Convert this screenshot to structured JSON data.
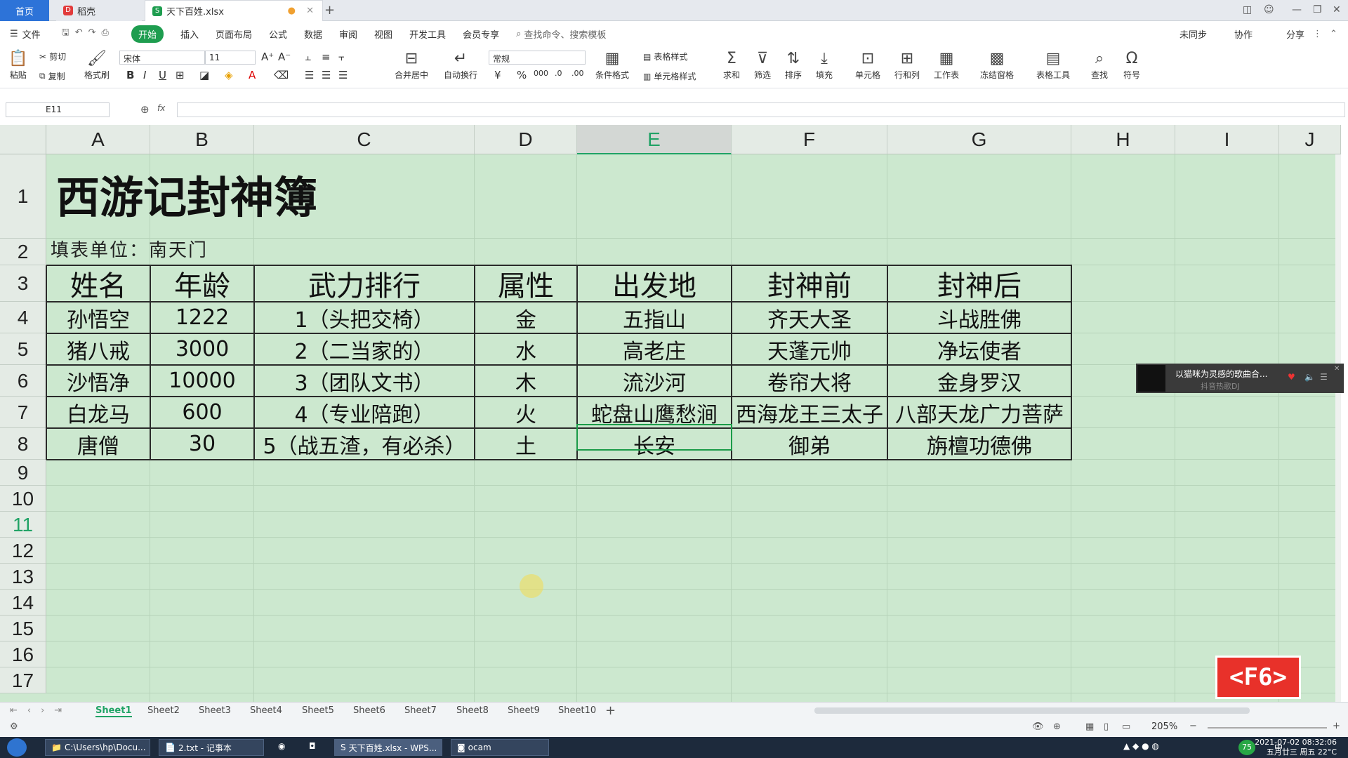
{
  "tabs": {
    "home": "首页",
    "daoke": "稻壳",
    "file": "天下百姓.xlsx"
  },
  "menu": [
    "文件",
    "开始",
    "插入",
    "页面布局",
    "公式",
    "数据",
    "审阅",
    "视图",
    "开发工具",
    "会员专享"
  ],
  "menu_search": "查找命令、搜索模板",
  "menu_right": [
    "未同步",
    "协作",
    "分享"
  ],
  "ribbon": {
    "paste": "粘贴",
    "cut": "剪切",
    "copy": "复制",
    "format_painter": "格式刷",
    "font": "宋体",
    "size": "11",
    "numfmt": "常规",
    "merge": "合并居中",
    "wrap": "自动换行",
    "cond_fmt": "条件格式",
    "table_style": "表格样式",
    "cell_style": "单元格样式",
    "sum": "求和",
    "filter": "筛选",
    "sort": "排序",
    "fill": "填充",
    "cell": "单元格",
    "rowcol": "行和列",
    "worksheet": "工作表",
    "freeze": "冻结窗格",
    "tools": "表格工具",
    "find": "查找",
    "symbol": "符号"
  },
  "namebox": "E11",
  "fx": "fx",
  "columns": [
    "A",
    "B",
    "C",
    "D",
    "E",
    "F",
    "G",
    "H",
    "I",
    "J"
  ],
  "rows": [
    "1",
    "2",
    "3",
    "4",
    "5",
    "6",
    "7",
    "8",
    "9",
    "10",
    "11",
    "12",
    "13",
    "14",
    "15",
    "16",
    "17"
  ],
  "title": "西游记封神簿",
  "unit": "填表单位：南天门",
  "headers": [
    "姓名",
    "年龄",
    "武力排行",
    "属性",
    "出发地",
    "封神前",
    "封神后"
  ],
  "data": [
    [
      "孙悟空",
      "1222",
      "1（头把交椅）",
      "金",
      "五指山",
      "齐天大圣",
      "斗战胜佛"
    ],
    [
      "猪八戒",
      "3000",
      "2（二当家的）",
      "水",
      "高老庄",
      "天蓬元帅",
      "净坛使者"
    ],
    [
      "沙悟净",
      "10000",
      "3（团队文书）",
      "木",
      "流沙河",
      "卷帘大将",
      "金身罗汉"
    ],
    [
      "白龙马",
      "600",
      "4（专业陪跑）",
      "火",
      "蛇盘山鹰愁涧",
      "西海龙王三太子",
      "八部天龙广力菩萨"
    ],
    [
      "唐僧",
      "30",
      "5（战五渣，有必杀）",
      "土",
      "长安",
      "御弟",
      "旃檀功德佛"
    ]
  ],
  "popup": {
    "title": "以猫咪为灵感的歌曲合...",
    "sub": "抖音热歌DJ"
  },
  "key_badge": "<F6>",
  "sheets": [
    "Sheet1",
    "Sheet2",
    "Sheet3",
    "Sheet4",
    "Sheet5",
    "Sheet6",
    "Sheet7",
    "Sheet8",
    "Sheet9",
    "Sheet10"
  ],
  "zoom": "205%",
  "taskbar": {
    "items": [
      "C:\\Users\\hp\\Docu...",
      "2.txt - 记事本",
      "天下百姓.xlsx - WPS...",
      "ocam"
    ],
    "ime": "中",
    "time": "2021-07-02 08:32:06",
    "date": "五月廿三 周五 22°C",
    "badge": "75"
  }
}
